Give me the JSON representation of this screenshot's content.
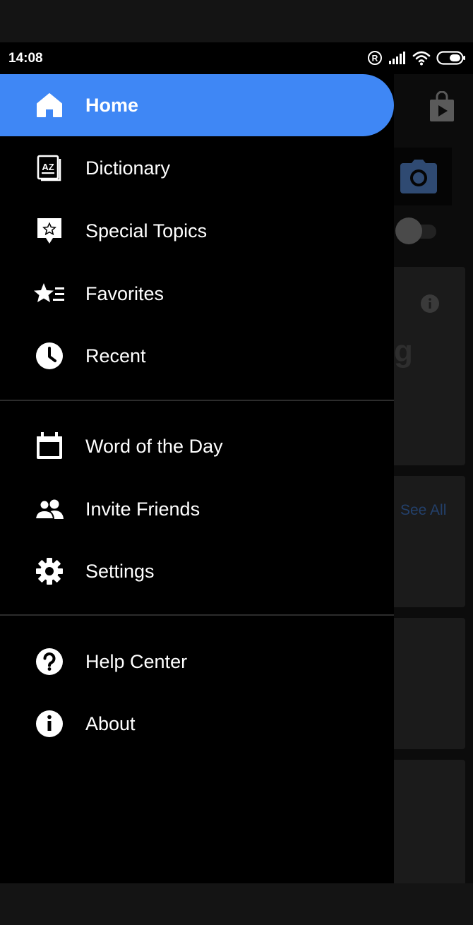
{
  "status_bar": {
    "time": "14:08"
  },
  "drawer": {
    "primary_items": [
      {
        "label": "Home",
        "icon": "home-icon",
        "active": true
      },
      {
        "label": "Dictionary",
        "icon": "dictionary-icon",
        "active": false
      },
      {
        "label": "Special Topics",
        "icon": "special-topics-icon",
        "active": false
      },
      {
        "label": "Favorites",
        "icon": "favorites-icon",
        "active": false
      },
      {
        "label": "Recent",
        "icon": "recent-clock-icon",
        "active": false
      }
    ],
    "secondary_items": [
      {
        "label": "Word of the Day",
        "icon": "calendar-icon"
      },
      {
        "label": "Invite Friends",
        "icon": "people-icon"
      },
      {
        "label": "Settings",
        "icon": "gear-icon"
      }
    ],
    "support_items": [
      {
        "label": "Help Center",
        "icon": "help-icon"
      },
      {
        "label": "About",
        "icon": "info-icon"
      }
    ],
    "accent_color": "#3f87f5"
  },
  "background": {
    "see_all_link": "See All"
  }
}
